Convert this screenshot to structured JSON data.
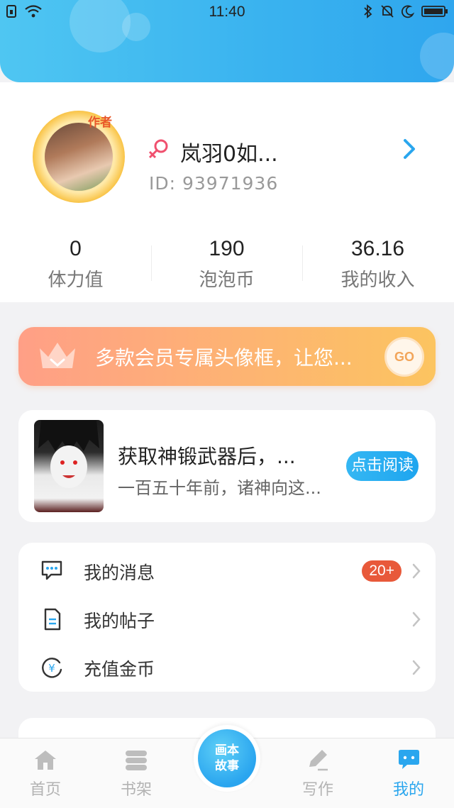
{
  "status_bar": {
    "time": "11:40"
  },
  "profile": {
    "author_tag": "作者",
    "username": "岚羽0如...",
    "user_id": "ID:  93971936"
  },
  "stats": [
    {
      "value": "0",
      "label": "体力值"
    },
    {
      "value": "190",
      "label": "泡泡币"
    },
    {
      "value": "36.16",
      "label": "我的收入"
    }
  ],
  "vip_banner": {
    "text": "多款会员专属头像框，让您...",
    "go_label": "GO"
  },
  "recommend": {
    "title": "获取神锻武器后，...",
    "desc": "一百五十年前，诸神向这...",
    "button": "点击阅读"
  },
  "menu": [
    {
      "label": "我的消息",
      "icon": "message-icon",
      "badge": "20+"
    },
    {
      "label": "我的帖子",
      "icon": "document-icon"
    },
    {
      "label": "充值金币",
      "icon": "coin-icon"
    }
  ],
  "tabbar": {
    "tabs": [
      {
        "label": "首页",
        "icon": "home-icon"
      },
      {
        "label": "书架",
        "icon": "bookshelf-icon"
      },
      {
        "label": "写作",
        "icon": "pen-icon"
      },
      {
        "label": "我的",
        "icon": "chat-bubble-icon"
      }
    ],
    "center_line1": "画本",
    "center_line2": "故事"
  },
  "colors": {
    "accent": "#2aa6ee",
    "badge": "#e8593a",
    "vip": "#fdb472"
  }
}
